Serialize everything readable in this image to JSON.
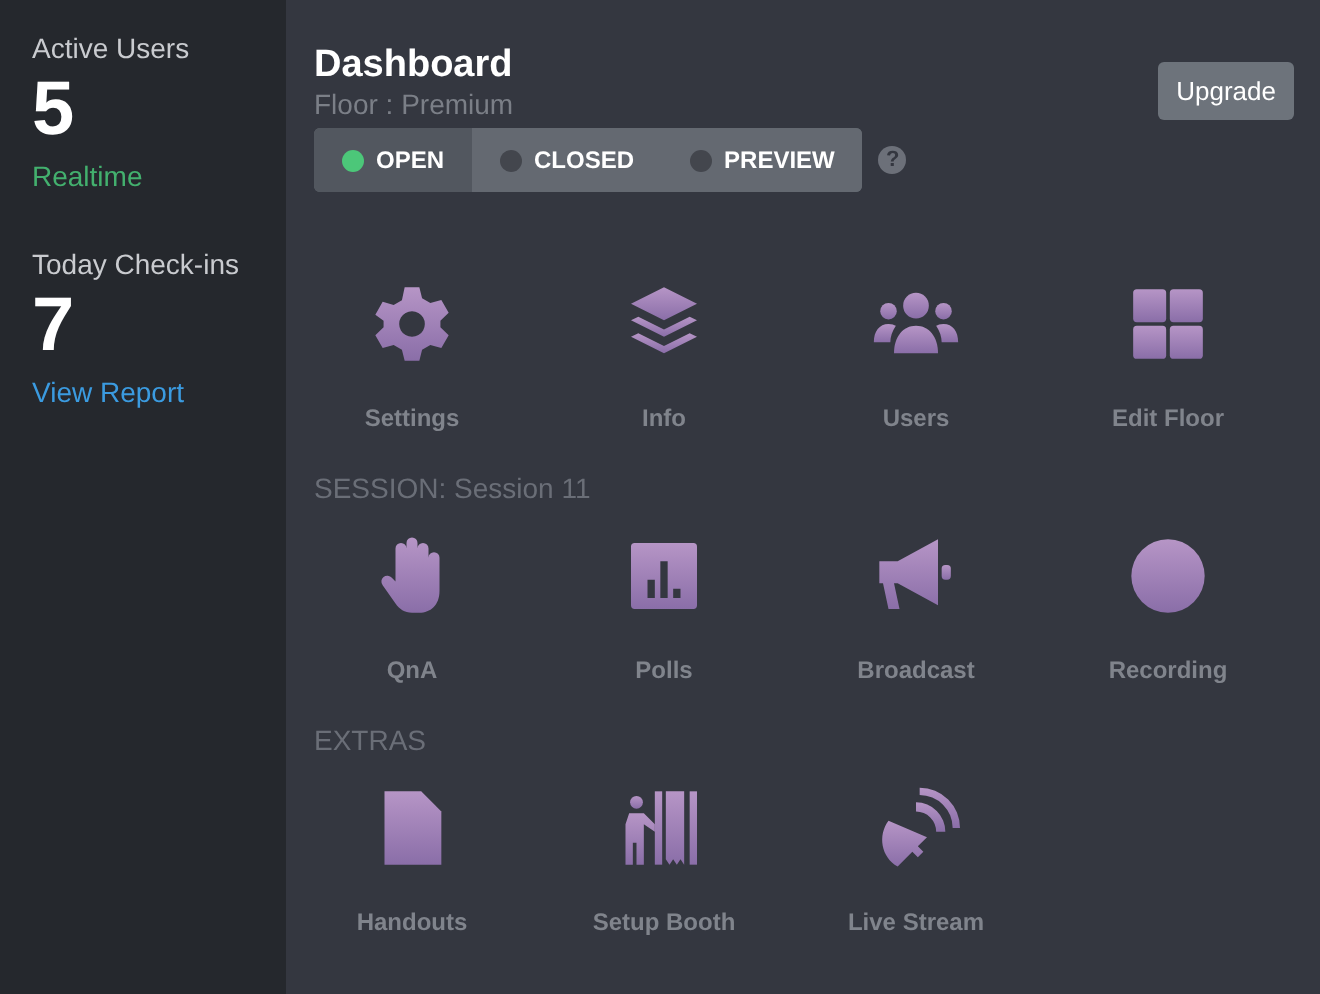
{
  "sidebar": {
    "stats": [
      {
        "label": "Active Users",
        "value": "5",
        "link": "Realtime",
        "kind": "live"
      },
      {
        "label": "Today Check-ins",
        "value": "7",
        "link": "View Report",
        "kind": "report"
      }
    ]
  },
  "header": {
    "title": "Dashboard",
    "subtitle": "Floor : Premium",
    "upgrade_button": "Upgrade"
  },
  "status": [
    {
      "label": "OPEN",
      "selected": true
    },
    {
      "label": "CLOSED",
      "selected": false
    },
    {
      "label": "PREVIEW",
      "selected": false
    }
  ],
  "help": "?",
  "sections": [
    {
      "tiles": [
        "Settings",
        "Info",
        "Users",
        "Edit Floor"
      ]
    },
    {
      "heading": "SESSION: Session 11",
      "tiles": [
        "QnA",
        "Polls",
        "Broadcast",
        "Recording"
      ]
    },
    {
      "heading": "EXTRAS",
      "tiles": [
        "Handouts",
        "Setup Booth",
        "Live Stream"
      ]
    }
  ]
}
